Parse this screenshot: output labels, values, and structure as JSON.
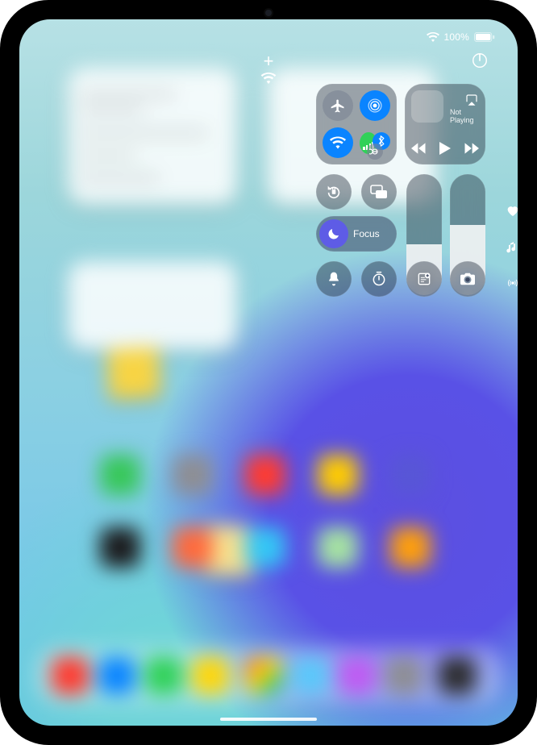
{
  "status": {
    "battery_percent_label": "100%",
    "wifi_icon": "wifi-icon",
    "battery_level": 100
  },
  "toprow": {
    "add_control_label": "+",
    "power_icon": "power-icon"
  },
  "control_center": {
    "connectivity": {
      "airplane_on": false,
      "airdrop_on": true,
      "wifi_on": true,
      "cellular_on": true,
      "bluetooth_on": true
    },
    "media": {
      "now_playing_label": "Not Playing"
    },
    "focus": {
      "label": "Focus"
    },
    "brightness": {
      "level_percent": 42
    },
    "volume": {
      "level_percent": 58
    },
    "bottom_row": {
      "silent_icon": "bell-icon",
      "timer_icon": "timer-icon",
      "note_icon": "quick-note-icon",
      "camera_icon": "camera-icon"
    }
  }
}
